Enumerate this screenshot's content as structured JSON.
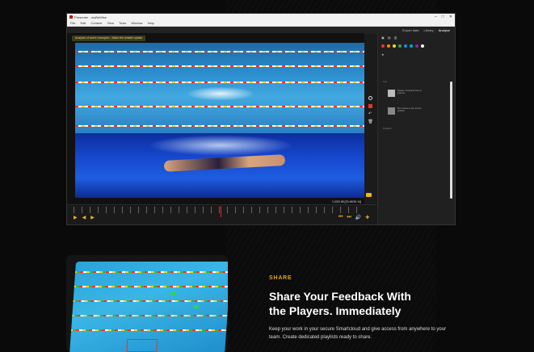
{
  "window": {
    "title": "Presenter - myBeWise",
    "menu": [
      "File",
      "Edit",
      "Content",
      "View",
      "Tools",
      "Window",
      "Help"
    ],
    "controls": [
      "–",
      "□",
      "✕"
    ]
  },
  "topnav": {
    "items": [
      "Export data",
      "Library",
      "Analyse"
    ],
    "active_index": 2
  },
  "clip": {
    "tag_label": "Analysis of world champion - Make the smaller splash",
    "timecode": "1.03/0.98 [25.48/30.14]"
  },
  "right_panel": {
    "colors": [
      "#e53935",
      "#fb8c00",
      "#fdd835",
      "#43a047",
      "#1e88e5",
      "#00acc1",
      "#8e24aa",
      "#ffffff"
    ],
    "list_label": "List",
    "items": [
      {
        "text": "Display: Freehand lines to improve"
      },
      {
        "text": "Mic Lecture in the current position"
      }
    ],
    "footer_label": "Position"
  },
  "bottom": {
    "tag": "SHARE",
    "title_line1": "Share Your Feedback With",
    "title_line2": "the Players. Immediately",
    "body": "Keep your work in your secure Smartcloud and give access from anywhere to your team. Create dedicated playlists ready to share."
  }
}
